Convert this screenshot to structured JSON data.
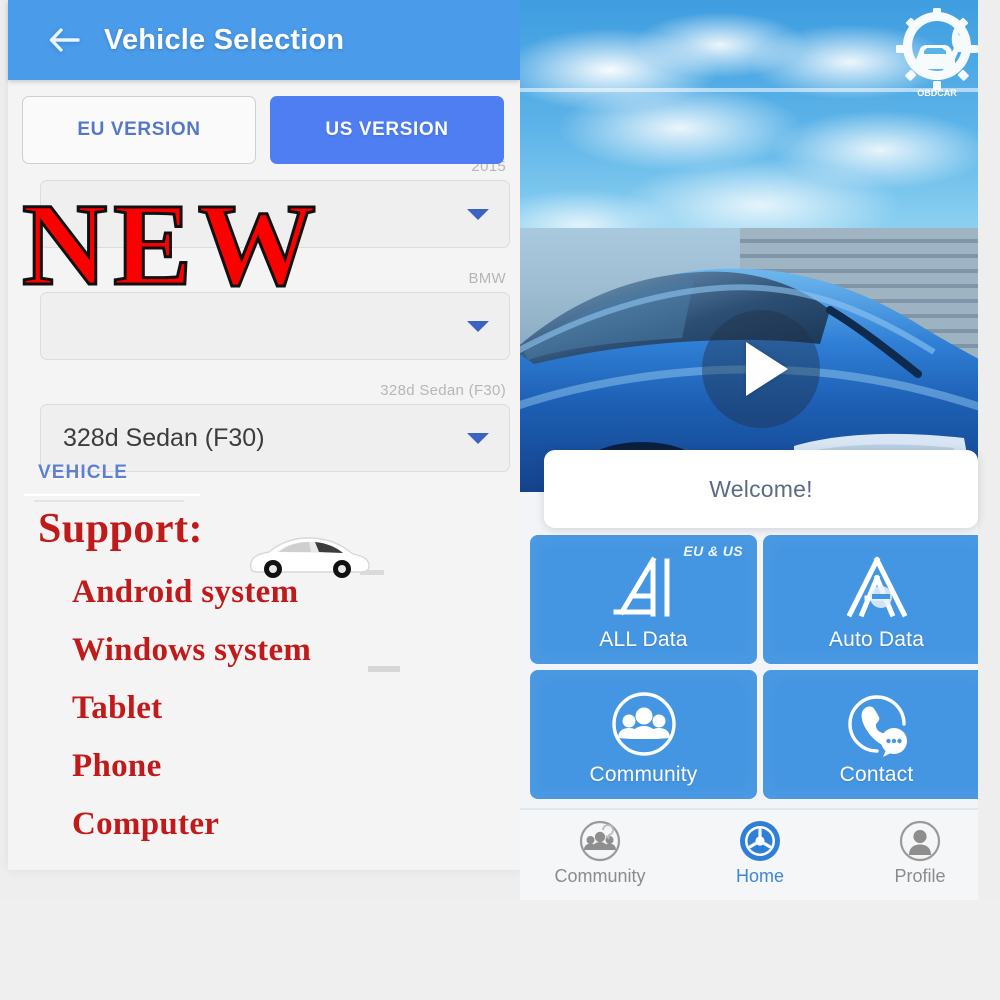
{
  "left_panel": {
    "appbar": {
      "back_icon": "back-arrow-icon",
      "title": "Vehicle Selection"
    },
    "version_tabs": [
      {
        "label": "EU VERSION",
        "active": false
      },
      {
        "label": "US VERSION",
        "active": true
      }
    ],
    "selectors": [
      {
        "hint": "2015",
        "value": "",
        "chevron": "chevron-down-icon"
      },
      {
        "hint": "BMW",
        "value": "",
        "chevron": "chevron-down-icon"
      },
      {
        "hint": "328d Sedan (F30)",
        "value": "328d Sedan (F30)",
        "chevron": "chevron-down-icon"
      }
    ],
    "section_label": "VEHICLE",
    "watermark": "NEW",
    "support": {
      "title": "Support:",
      "items": [
        "Android system",
        "Windows system",
        "Tablet",
        "Phone",
        "Computer"
      ],
      "car_icon": "white-sports-car-icon"
    },
    "colors": {
      "appbar_blue": "#4a9bea",
      "tab_active_blue": "#4e7ef2",
      "watermark_red": "#fc0000",
      "support_red": "#c01a1a",
      "vehicle_label_blue": "#5f7fd4"
    }
  },
  "right_panel": {
    "brand_logo": {
      "icon": "gear-car-wrench-logo-icon",
      "text": "OBDCAR"
    },
    "video": {
      "play_icon": "play-triangle-icon"
    },
    "welcome_card": {
      "text": "Welcome!"
    },
    "tiles": [
      {
        "label": "ALL Data",
        "badge": "EU & US",
        "icon": "alldata-a-logo-icon"
      },
      {
        "label": "Auto Data",
        "badge": "",
        "icon": "autodata-a-logo-icon"
      },
      {
        "label": "Community",
        "badge": "",
        "icon": "community-people-icon"
      },
      {
        "label": "Contact",
        "badge": "",
        "icon": "contact-phone-chat-icon"
      }
    ],
    "bottom_nav": [
      {
        "label": "Community",
        "icon": "community-people-icon",
        "active": false
      },
      {
        "label": "Home",
        "icon": "tire-wheel-icon",
        "active": true
      },
      {
        "label": "Profile",
        "icon": "person-avatar-icon",
        "active": false
      }
    ],
    "colors": {
      "tile_blue": "#4596e2",
      "nav_active_blue": "#3f86d8",
      "nav_inactive_gray": "#8b8b8b"
    }
  }
}
